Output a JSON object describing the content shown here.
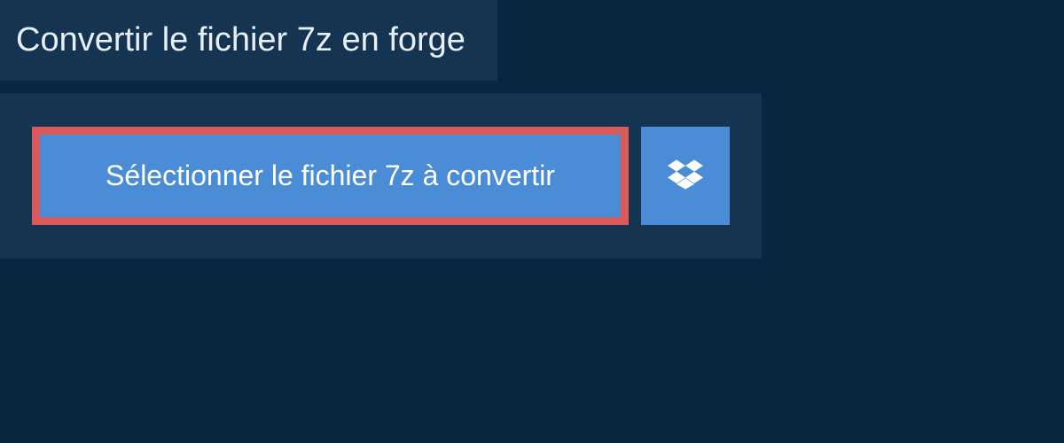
{
  "header": {
    "title": "Convertir le fichier 7z en forge"
  },
  "actions": {
    "select_file_label": "Sélectionner le fichier 7z à convertir"
  },
  "colors": {
    "page_bg": "#0a2540",
    "panel_bg": "#143452",
    "button_bg": "#4a8dd6",
    "highlight_border": "#d85a5a",
    "text_light": "#ffffff"
  }
}
